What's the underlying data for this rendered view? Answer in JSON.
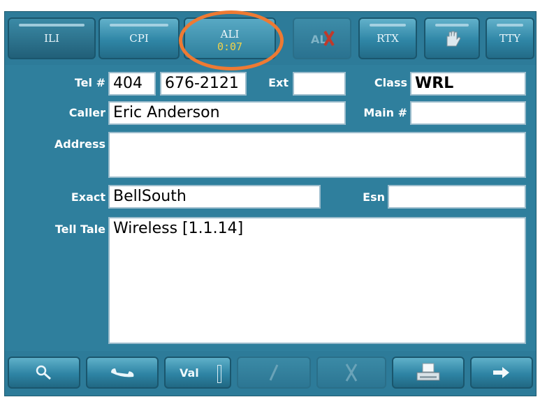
{
  "tabs": {
    "ili": "ILI",
    "cpi": "CPI",
    "ali": "ALI",
    "ali_timer": "0:07",
    "rtx": "RTX",
    "tty": "TTY"
  },
  "form": {
    "tel_label": "Tel #",
    "tel_area": "404",
    "tel_number": "676-2121",
    "ext_label": "Ext",
    "ext_value": "",
    "class_label": "Class",
    "class_value": "WRL",
    "caller_label": "Caller",
    "caller_value": "Eric Anderson",
    "main_label": "Main #",
    "main_value": "",
    "address_label": "Address",
    "address_value": "",
    "exact_label": "Exact",
    "exact_value": "BellSouth",
    "esn_label": "Esn",
    "esn_value": "",
    "telltale_label": "Tell Tale",
    "telltale_value": "Wireless [1.1.14]"
  },
  "toolbar": {
    "val_label": "Val"
  },
  "icons": [
    "alert-x-icon",
    "hand-icon",
    "search-icon",
    "phone-handset-icon",
    "slash-icon",
    "cross-icon",
    "printer-icon",
    "arrow-right-icon"
  ],
  "colors": {
    "panel": "#2f7f9d",
    "timer": "#f0d24a",
    "highlight_ring": "#ee7a33"
  }
}
